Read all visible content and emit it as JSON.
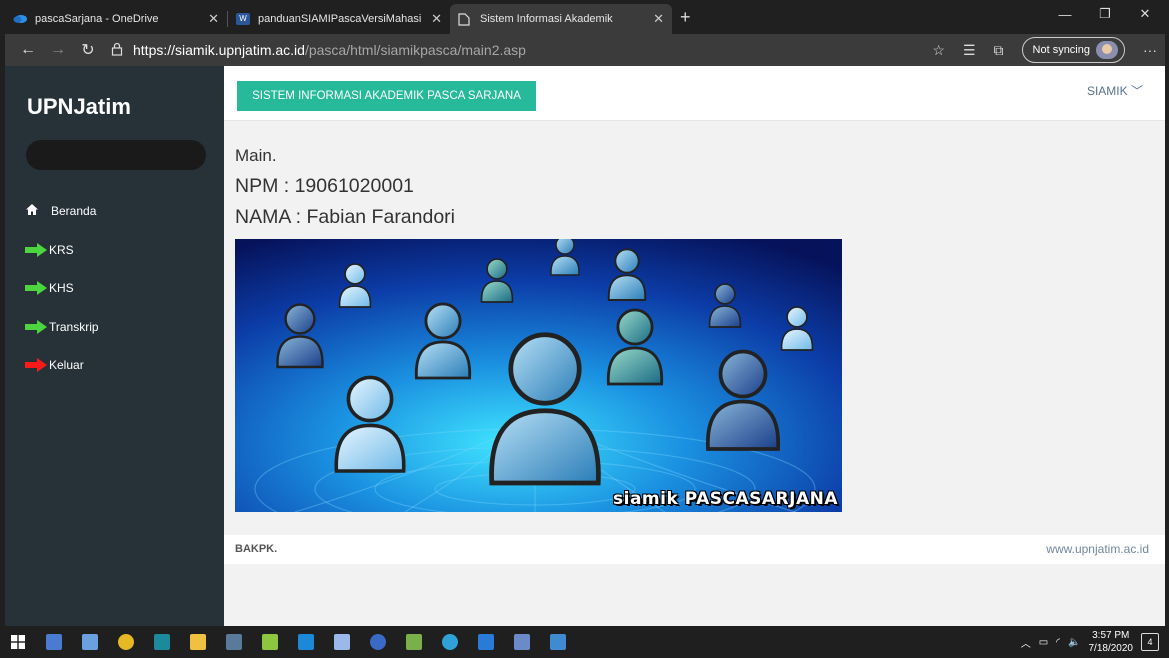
{
  "browser": {
    "tabs": [
      {
        "title": "pascaSarjana - OneDrive",
        "icon": "onedrive-icon",
        "active": false
      },
      {
        "title": "panduanSIAMIPascaVersiMahasi",
        "icon": "word-icon",
        "active": false
      },
      {
        "title": "Sistem Informasi Akademik",
        "icon": "page-icon",
        "active": true
      }
    ],
    "url_host": "https://siamik.upnjatim.ac.id",
    "url_path": "/pasca/html/siamikpasca/main2.asp",
    "sync_label": "Not syncing"
  },
  "sidebar": {
    "brand": "UPNJatim",
    "items": [
      {
        "label": "Beranda",
        "icon": "home-icon"
      },
      {
        "label": "KRS",
        "icon": "green-arrow-icon"
      },
      {
        "label": "KHS",
        "icon": "green-arrow-icon"
      },
      {
        "label": "Transkrip",
        "icon": "green-arrow-icon"
      },
      {
        "label": "Keluar",
        "icon": "red-arrow-icon"
      }
    ]
  },
  "topnav": {
    "app_button": "SISTEM INFORMASI AKADEMIK PASCA SARJANA",
    "user_menu": "SIAMIK"
  },
  "main": {
    "heading": "Main.",
    "npm": "NPM : 19061020001",
    "nama": "NAMA : Fabian Farandori",
    "banner_caption": "siamik PASCASARJANA"
  },
  "footer": {
    "left": "BAKPK.",
    "right": "www.upnjatim.ac.id"
  },
  "taskbar": {
    "time": "3:57 PM",
    "date": "7/18/2020",
    "notifications": "4"
  },
  "colors": {
    "accent": "#26b99a",
    "sidebar": "#263238"
  }
}
